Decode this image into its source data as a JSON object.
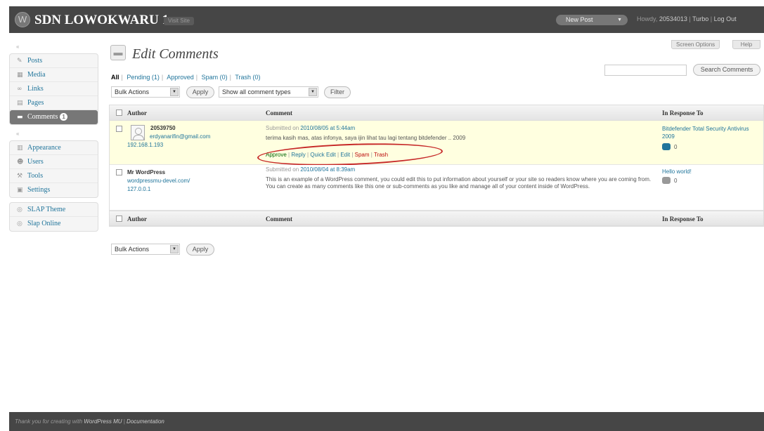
{
  "header": {
    "site_title": "SDN LOWOKWARU 1",
    "visit_site": "Visit Site",
    "new_post": "New Post",
    "greeting_prefix": "Howdy,",
    "user": "20534013",
    "turbo": "Turbo",
    "logout": "Log Out"
  },
  "top_buttons": {
    "screen_options": "Screen Options",
    "help": "Help"
  },
  "sidebar": {
    "group1": [
      {
        "label": "Posts",
        "icon": "posts-icon"
      },
      {
        "label": "Media",
        "icon": "media-icon"
      },
      {
        "label": "Links",
        "icon": "links-icon"
      },
      {
        "label": "Pages",
        "icon": "pages-icon"
      },
      {
        "label": "Comments",
        "icon": "comments-icon",
        "badge": "1",
        "active": true
      }
    ],
    "group2": [
      {
        "label": "Appearance",
        "icon": "appearance-icon"
      },
      {
        "label": "Users",
        "icon": "users-icon"
      },
      {
        "label": "Tools",
        "icon": "tools-icon"
      },
      {
        "label": "Settings",
        "icon": "settings-icon"
      }
    ],
    "group3": [
      {
        "label": "SLAP Theme",
        "icon": "slap-theme-icon"
      },
      {
        "label": "Slap Online",
        "icon": "slap-online-icon"
      }
    ]
  },
  "page": {
    "title": "Edit Comments"
  },
  "filters": {
    "all": "All",
    "pending": "Pending (1)",
    "approved": "Approved",
    "spam": "Spam (0)",
    "trash": "Trash (0)"
  },
  "search": {
    "value": "",
    "button": "Search Comments"
  },
  "bulk": {
    "label": "Bulk Actions",
    "apply": "Apply",
    "type_filter": "Show all comment types",
    "filter": "Filter"
  },
  "table": {
    "col_author": "Author",
    "col_comment": "Comment",
    "col_response": "In Response To",
    "rows": [
      {
        "author": "20539750",
        "email": "erdyanarifin@gmail.com",
        "ip": "192.168.1.193",
        "submitted_prefix": "Submitted on",
        "submitted_date": "2010/08/05 at 5:44am",
        "comment": "terima kasih mas, atas infonya, saya ijin lihat tau lagi tentang bitdefender .. 2009",
        "actions": {
          "approve": "Approve",
          "reply": "Reply",
          "quick_edit": "Quick Edit",
          "edit": "Edit",
          "spam": "Spam",
          "trash": "Trash"
        },
        "response_title": "Bitdefender Total Security Antivirus 2009",
        "response_count": "0",
        "bubble_color": "#21759b"
      },
      {
        "author": "Mr WordPress",
        "url": "wordpressmu-devel.com/",
        "ip": "127.0.0.1",
        "submitted_prefix": "Submitted on",
        "submitted_date": "2010/08/04 at 8:39am",
        "comment": "This is an example of a WordPress comment, you could edit this to put information about yourself or your site so readers know where you are coming from. You can create as many comments like this one or sub-comments as you like and manage all of your content inside of WordPress.",
        "response_title": "Hello world!",
        "response_count": "0",
        "bubble_color": "#999999"
      }
    ]
  },
  "footer": {
    "text_prefix": "Thank you for creating with",
    "link1": "WordPress MU",
    "link2": "Documentation"
  }
}
